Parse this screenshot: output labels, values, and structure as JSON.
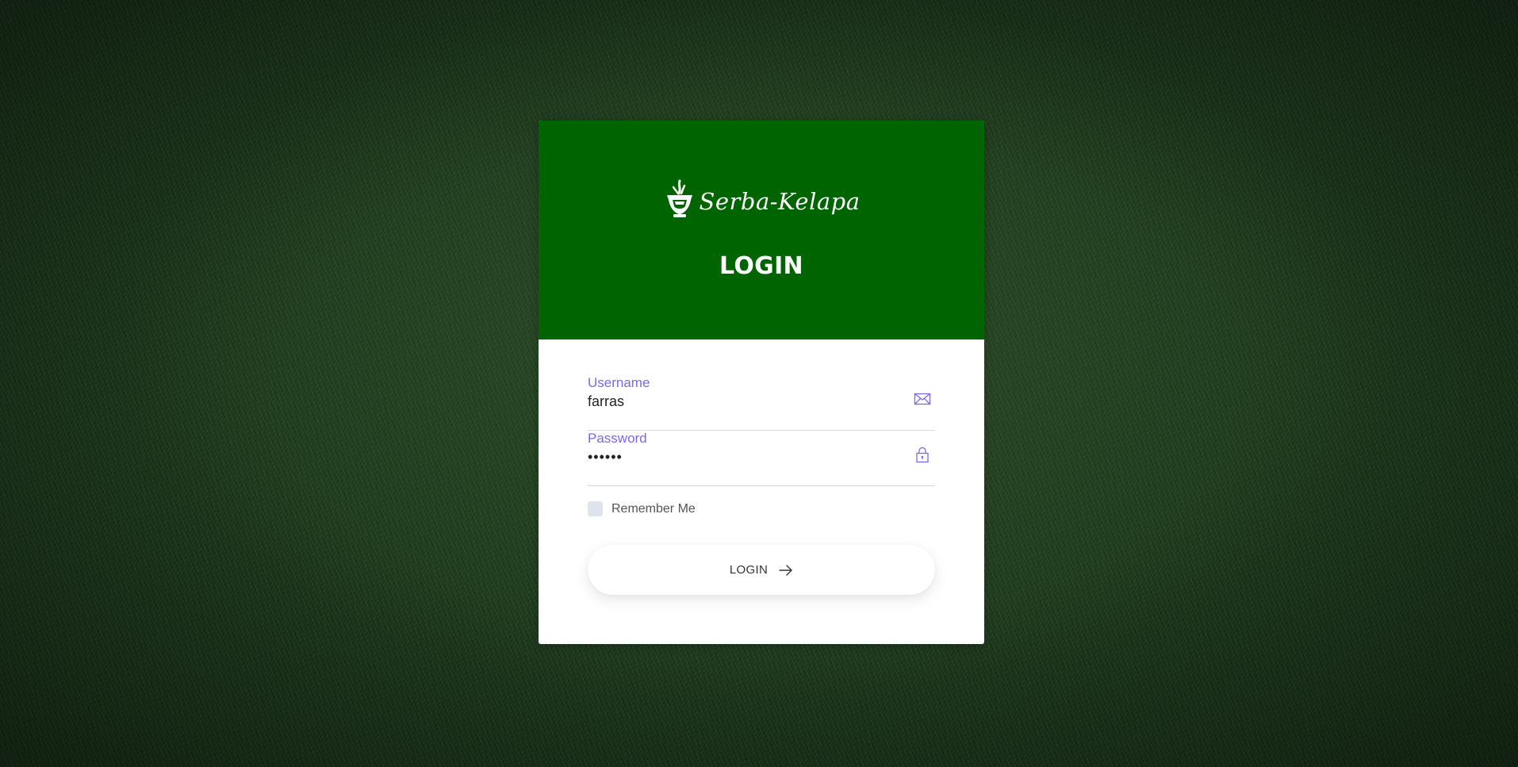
{
  "brand": {
    "name": "Serba-Kelapa",
    "logo_icon": "mortar-pestle-logo"
  },
  "header": {
    "title": "LOGIN",
    "background_color": "#006400"
  },
  "form": {
    "username": {
      "label": "Username",
      "value": "farras",
      "icon": "envelope-icon"
    },
    "password": {
      "label": "Password",
      "value": "••••••",
      "icon": "lock-icon"
    },
    "remember_label": "Remember Me",
    "remember_checked": false,
    "submit_label": "LOGIN",
    "submit_icon": "arrow-right-icon"
  },
  "colors": {
    "accent": "#7b68ee",
    "header_green": "#006400"
  }
}
